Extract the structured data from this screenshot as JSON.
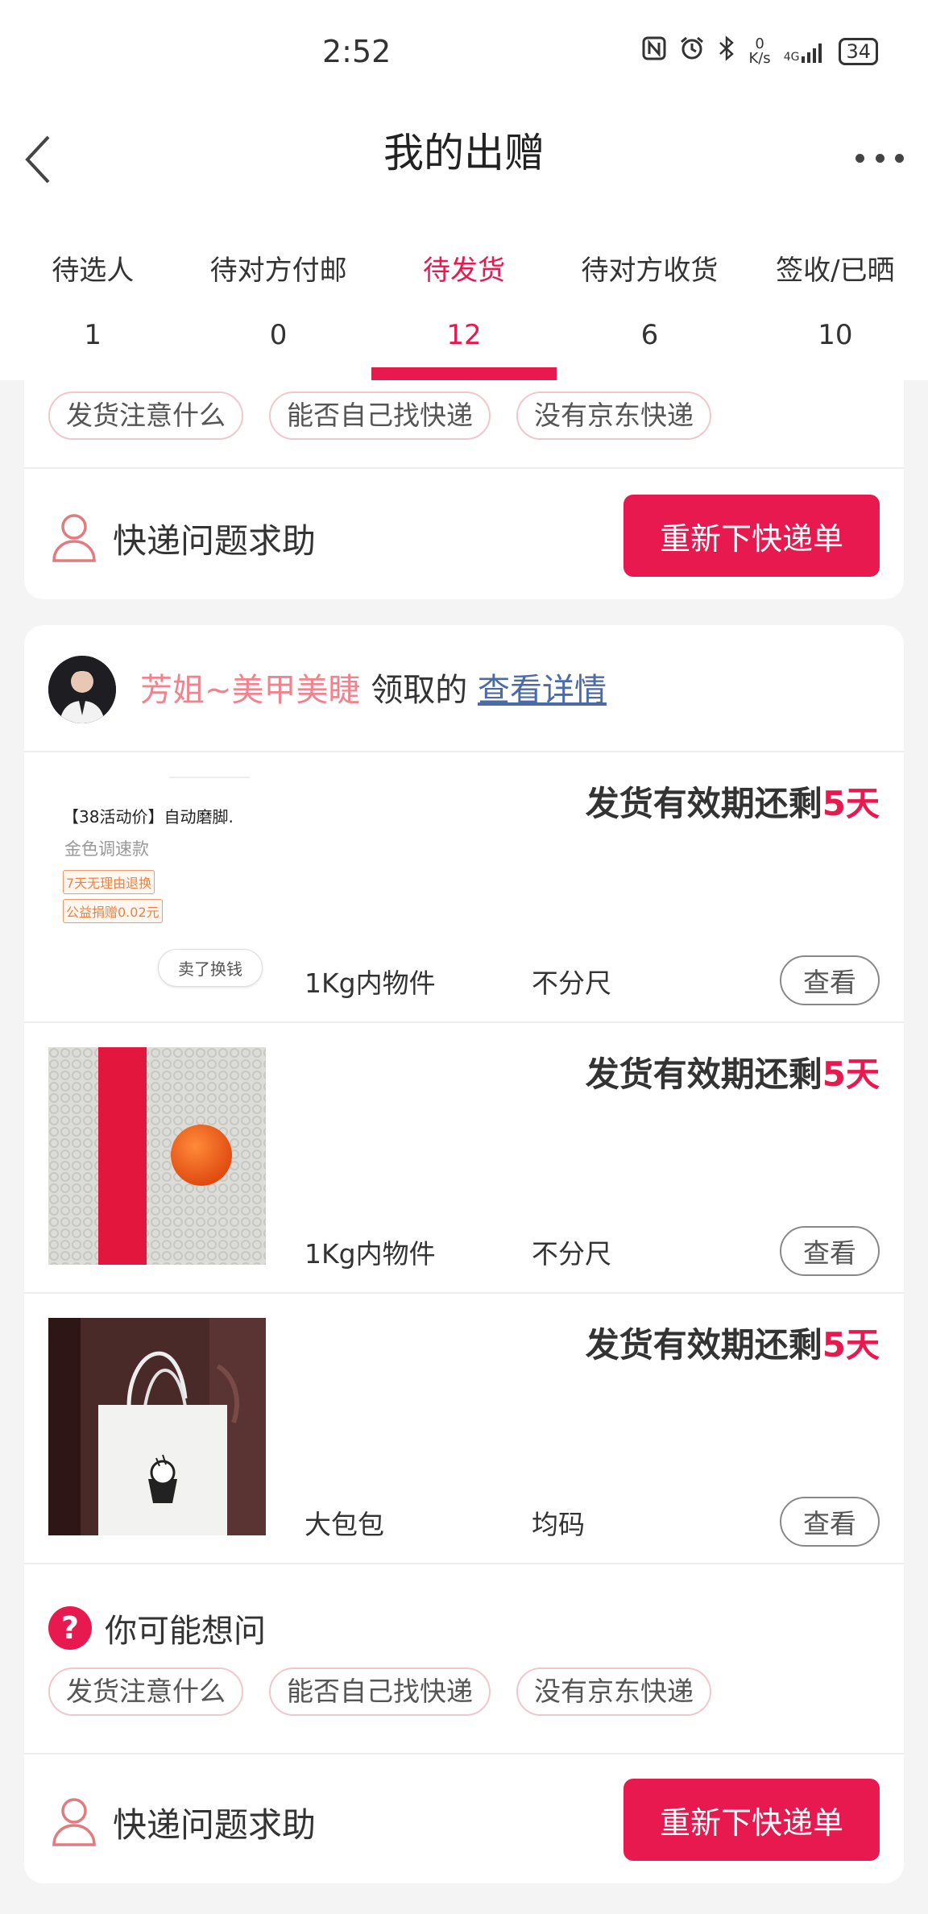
{
  "status_bar": {
    "time": "2:52",
    "net_speed_value": "0",
    "net_speed_unit": "K/s",
    "signal_label": "4G",
    "battery": "34"
  },
  "header": {
    "title": "我的出赠"
  },
  "tabs": [
    {
      "label": "待选人",
      "count": "1"
    },
    {
      "label": "待对方付邮",
      "count": "0"
    },
    {
      "label": "待发货",
      "count": "12"
    },
    {
      "label": "待对方收货",
      "count": "6"
    },
    {
      "label": "签收/已晒",
      "count": "10"
    }
  ],
  "active_tab_index": 2,
  "top_card": {
    "faq_chips": [
      "发货注意什么",
      "能否自己找快递",
      "没有京东快递"
    ],
    "help_text": "快递问题求助",
    "reorder_button": "重新下快递单"
  },
  "order": {
    "claimer_name": "芳姐~美甲美睫",
    "claim_suffix": "领取的",
    "details_link": "查看详情",
    "items": [
      {
        "thumb": "product-screenshot",
        "thumb_title": "【38活动价】自动磨脚.",
        "thumb_spec": "金色调速款",
        "thumb_tags": [
          "7天无理由退换",
          "公益捐赠0.02元"
        ],
        "thumb_sell": "卖了换钱",
        "deadline_prefix": "发货有效期还剩",
        "deadline_days": "5天",
        "weight": "1Kg内物件",
        "size": "不分尺",
        "view_button": "查看"
      },
      {
        "thumb": "orange-ball-photo",
        "deadline_prefix": "发货有效期还剩",
        "deadline_days": "5天",
        "weight": "1Kg内物件",
        "size": "不分尺",
        "view_button": "查看"
      },
      {
        "thumb": "tote-bag-photo",
        "deadline_prefix": "发货有效期还剩",
        "deadline_days": "5天",
        "weight": "大包包",
        "size": "均码",
        "view_button": "查看"
      }
    ],
    "faq_title": "你可能想问",
    "faq_chips": [
      "发货注意什么",
      "能否自己找快递",
      "没有京东快递"
    ],
    "help_text": "快递问题求助",
    "reorder_button": "重新下快递单"
  },
  "colors": {
    "accent": "#e8194f",
    "link": "#4a6aa8",
    "claimer": "#f0848e"
  }
}
